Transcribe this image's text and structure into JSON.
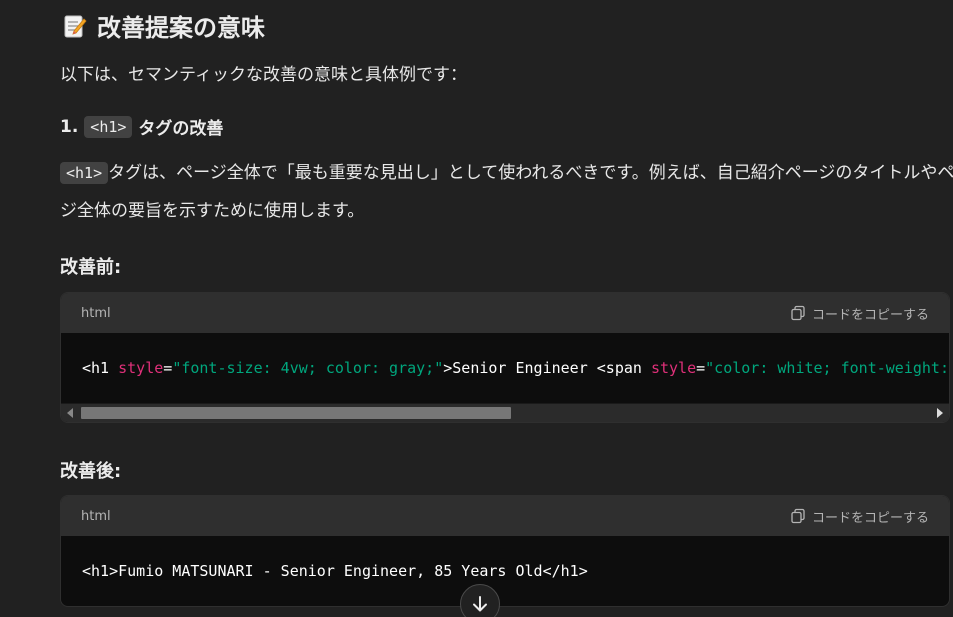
{
  "section": {
    "icon": "memo-icon",
    "title": "改善提案の意味"
  },
  "intro": "以下は、セマンティックな改善の意味と具体例です：",
  "item1": {
    "number": "1.",
    "code": "<h1>",
    "suffix": "タグの改善"
  },
  "paragraph": {
    "code": "<h1>",
    "line1_rest": "タグは、ページ全体で「最も重要な見出し」として使われるべきです。例えば、自己紹介ページのタイトルやペー",
    "line2": "ジ全体の要旨を示すために使用します。"
  },
  "before": {
    "label": "改善前:",
    "lang": "html",
    "copy_label": "コードをコピーする",
    "tokens": [
      {
        "t": "<h1 ",
        "c": "plain"
      },
      {
        "t": "style",
        "c": "attr"
      },
      {
        "t": "=",
        "c": "plain"
      },
      {
        "t": "\"font-size: 4vw; color: gray;\"",
        "c": "str"
      },
      {
        "t": ">Senior Engineer <span ",
        "c": "plain"
      },
      {
        "t": "style",
        "c": "attr"
      },
      {
        "t": "=",
        "c": "plain"
      },
      {
        "t": "\"color: white; font-weight: bold;\"",
        "c": "str"
      }
    ]
  },
  "after": {
    "label": "改善後:",
    "lang": "html",
    "copy_label": "コードをコピーする",
    "code": "<h1>Fumio MATSUNARI - Senior Engineer, 85 Years Old</h1>"
  },
  "colors": {
    "background": "#212121",
    "code_bg": "#0d0d0d",
    "code_header_bg": "#2f2f2f",
    "attr": "#df3079",
    "string": "#00a67d"
  }
}
